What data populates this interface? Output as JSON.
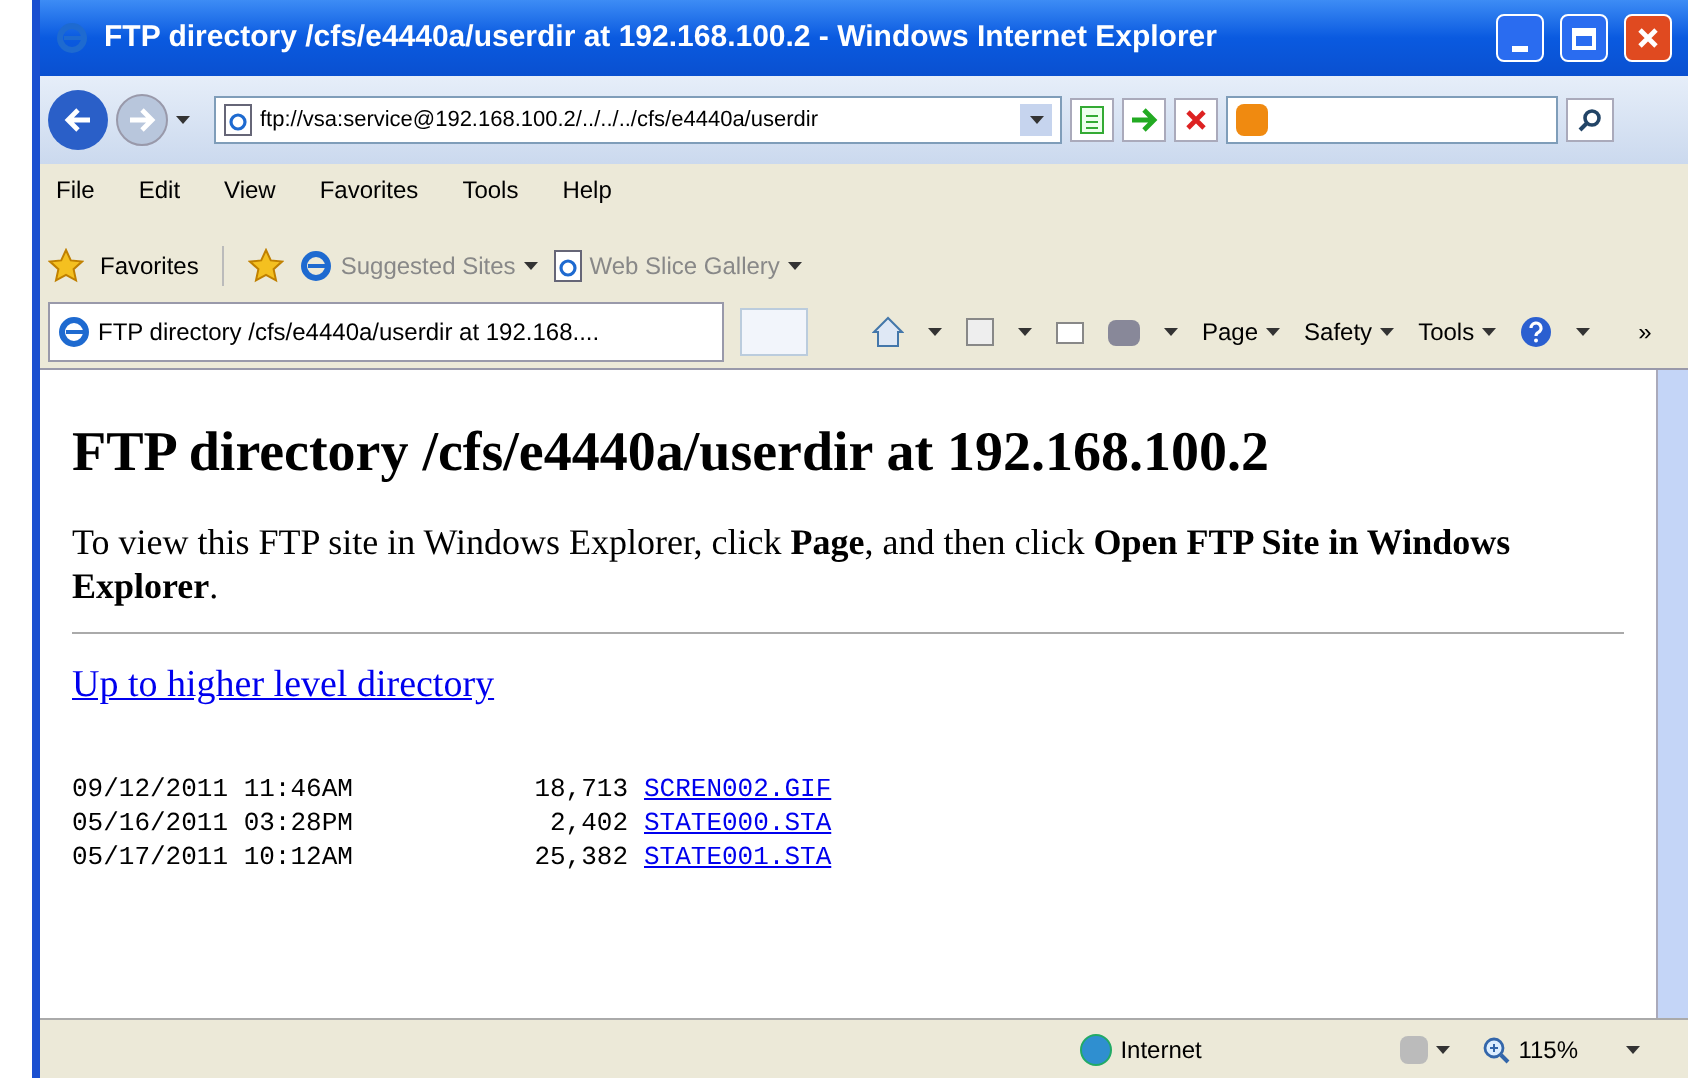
{
  "window": {
    "title": "FTP directory /cfs/e4440a/userdir at 192.168.100.2 - Windows Internet Explorer"
  },
  "address_bar": {
    "value": "ftp://vsa:service@192.168.100.2/../../../cfs/e4440a/userdir"
  },
  "menu": [
    "File",
    "Edit",
    "View",
    "Favorites",
    "Tools",
    "Help"
  ],
  "favorites_bar": {
    "label": "Favorites",
    "items": [
      {
        "label": "Suggested Sites",
        "kind": "ie"
      },
      {
        "label": "Web Slice Gallery",
        "kind": "page"
      }
    ]
  },
  "tab": {
    "title": "FTP directory /cfs/e4440a/userdir at 192.168....",
    "selected": true
  },
  "command_bar": {
    "items": [
      "Page",
      "Safety",
      "Tools"
    ],
    "overflow": "»"
  },
  "page": {
    "heading": "FTP directory /cfs/e4440a/userdir at 192.168.100.2",
    "intro": "To view this FTP site in Windows Explorer, click **Page**, and then click **Open FTP Site in Windows Explorer**.",
    "up_link": "Up to higher level directory",
    "files": [
      {
        "date": "09/12/2011 11:46AM",
        "size": "18,713",
        "name": "SCREN002.GIF"
      },
      {
        "date": "05/16/2011 03:28PM",
        "size": "2,402",
        "name": "STATE000.STA"
      },
      {
        "date": "05/17/2011 10:12AM",
        "size": "25,382",
        "name": "STATE001.STA"
      }
    ]
  },
  "status_bar": {
    "zone": "Internet",
    "zoom": "115%"
  }
}
